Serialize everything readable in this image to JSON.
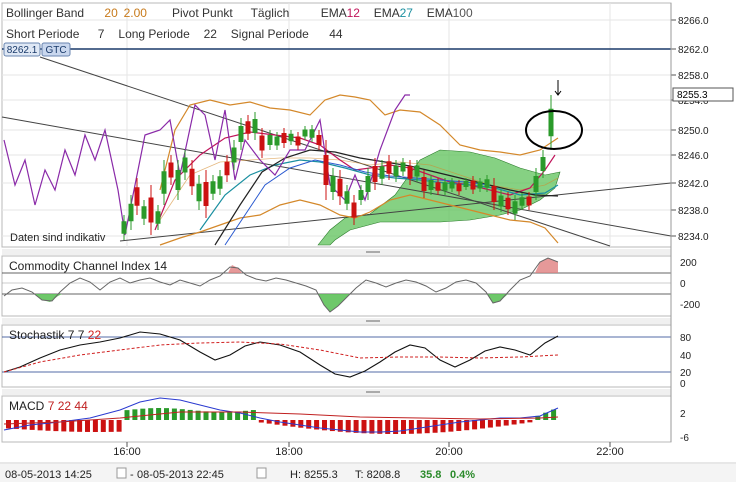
{
  "header": {
    "line1": [
      {
        "text": "Bollinger Band",
        "color": "#333333"
      },
      {
        "text": "20",
        "color": "#c87a1a"
      },
      {
        "text": "2.00",
        "color": "#c87a1a"
      },
      {
        "text": "Pivot Punkt",
        "color": "#333333"
      },
      {
        "text": "Täglich",
        "color": "#333333"
      },
      {
        "text": "EMA",
        "color": "#333333"
      },
      {
        "text": "12",
        "color": "#c0145a"
      },
      {
        "text": "EMA",
        "color": "#333333"
      },
      {
        "text": "27",
        "color": "#1a8fa0"
      },
      {
        "text": "EMA",
        "color": "#333333"
      },
      {
        "text": "100",
        "color": "#555555"
      }
    ],
    "line2": [
      {
        "text": "Short Periode",
        "color": "#333333"
      },
      {
        "text": "7",
        "color": "#333333"
      },
      {
        "text": "Long Periode",
        "color": "#333333"
      },
      {
        "text": "22",
        "color": "#333333"
      },
      {
        "text": "Signal Periode",
        "color": "#333333"
      },
      {
        "text": "44",
        "color": "#333333"
      }
    ]
  },
  "order_line": {
    "price": "8262.1",
    "tag": "GTC"
  },
  "current_price_label": "8255.3",
  "indicative_note": "Daten sind indikativ",
  "price_axis": [
    "8266.0",
    "8262.0",
    "8258.0",
    "8254.0",
    "8250.0",
    "8246.0",
    "8242.0",
    "8238.0",
    "8234.0"
  ],
  "cci": {
    "title": "Commodity Channel Index",
    "period": "14",
    "axis": [
      "200",
      "0",
      "-200"
    ]
  },
  "stoch": {
    "title": "Stochastik",
    "p1": "7",
    "p2": "7",
    "p3": "22",
    "axis": [
      "80",
      "40",
      "20",
      "0"
    ]
  },
  "macd": {
    "title": "MACD",
    "p1": "7",
    "p2": "22",
    "p3": "44",
    "axis": [
      "2",
      "-6"
    ]
  },
  "time_axis": [
    "16:00",
    "18:00",
    "20:00",
    "22:00"
  ],
  "status_bar": {
    "start": "08-05-2013 14:25",
    "end": "08-05-2013 22:45",
    "h_label": "H:",
    "h": "8255.3",
    "t_label": "T:",
    "t": "8208.8",
    "change": "35.8",
    "pct": "0.4%"
  },
  "colors": {
    "up": "#2a9a2a",
    "down": "#cc1111",
    "cloud": "#5ec25a",
    "bollinger": "#d4882a",
    "ema12": "#c0145a",
    "ema27": "#1a8fa0",
    "purple": "#8a2aa8",
    "order": "#1a3a6a"
  },
  "chart_data": [
    {
      "type": "candlestick",
      "title": "",
      "ylim": [
        8232,
        8268
      ],
      "note": "price chart with Bollinger band, pivot lines, EMA 12/27/100 and cloud"
    },
    {
      "type": "line",
      "title": "Commodity Channel Index 14",
      "ylim": [
        -300,
        250
      ]
    },
    {
      "type": "line",
      "title": "Stochastik 7 7 22",
      "ylim": [
        0,
        100
      ]
    },
    {
      "type": "bar",
      "title": "MACD 7 22 44",
      "ylim": [
        -8,
        4
      ]
    }
  ]
}
